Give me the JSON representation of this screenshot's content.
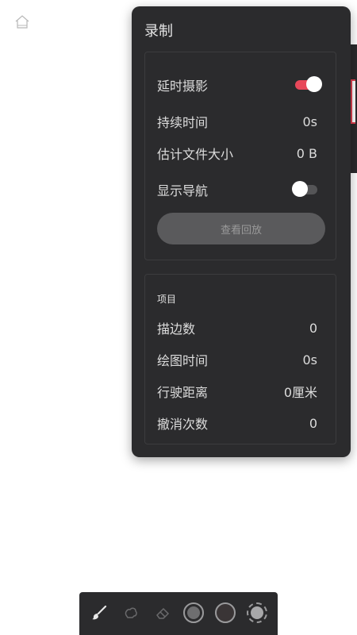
{
  "panel": {
    "title": "录制"
  },
  "recording": {
    "timelapse_label": "延时摄影",
    "timelapse_on": true,
    "duration_label": "持续时间",
    "duration_value": "0s",
    "filesize_label": "估计文件大小",
    "filesize_value": "0 B",
    "nav_label": "显示导航",
    "nav_on": false,
    "replay_button": "查看回放"
  },
  "project": {
    "section_title": "项目",
    "strokes_label": "描边数",
    "strokes_value": "0",
    "drawtime_label": "绘图时间",
    "drawtime_value": "0s",
    "distance_label": "行驶距离",
    "distance_value": "0厘米",
    "undo_label": "撤消次数",
    "undo_value": "0"
  },
  "toolbar": {
    "tools": [
      "brush-icon",
      "smudge-icon",
      "eraser-icon",
      "brush-size-icon",
      "color-swatch-icon",
      "opacity-icon"
    ]
  },
  "colors": {
    "panel_bg": "#2b2b2d",
    "accent": "#e8485a",
    "text": "#dcdcdc"
  }
}
